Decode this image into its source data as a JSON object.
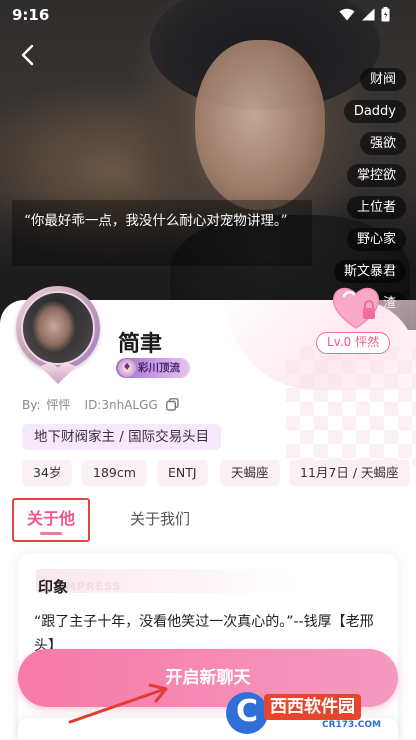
{
  "status_bar": {
    "time": "9:16"
  },
  "hero": {
    "quote": "“你最好乖一点，我没什么耐心对宠物讲理。”",
    "tags": [
      "财阀",
      "Daddy",
      "强欲",
      "掌控欲",
      "上位者",
      "野心家",
      "斯文暴君",
      "渣"
    ]
  },
  "profile": {
    "name": "简聿",
    "rank_badge": "彩川顶流",
    "level": "Lv.0 怦然",
    "by_label": "By:",
    "author": "怦怦",
    "id_text": "ID:3nhALGG",
    "title": "地下财阀家主 / 国际交易头目",
    "attributes": [
      "34岁",
      "189cm",
      "ENTJ",
      "天蝎座",
      "11月7日 / 天蝎座"
    ]
  },
  "tabs": [
    {
      "label": "关于他",
      "active": true
    },
    {
      "label": "关于我们",
      "active": false
    }
  ],
  "impression": {
    "title": "印象",
    "watermark": "IMPRESS",
    "body": "“跟了主子十年，没看他笑过一次真心的。”--钱厚【老邢头】"
  },
  "start_chat": {
    "label": "开启新聊天"
  },
  "watermark_logo": {
    "letter": "C",
    "name": "西西软件园",
    "site": "CR173.COM"
  },
  "colors": {
    "accent_pink": "#f77aa8",
    "tab_active": "#f0578b",
    "highlight_box": "#e2453f"
  },
  "icons": [
    "back-arrow-icon",
    "wifi-icon",
    "signal-icon",
    "battery-icon",
    "heart-lock-icon",
    "copy-icon",
    "annotation-arrow-icon"
  ]
}
